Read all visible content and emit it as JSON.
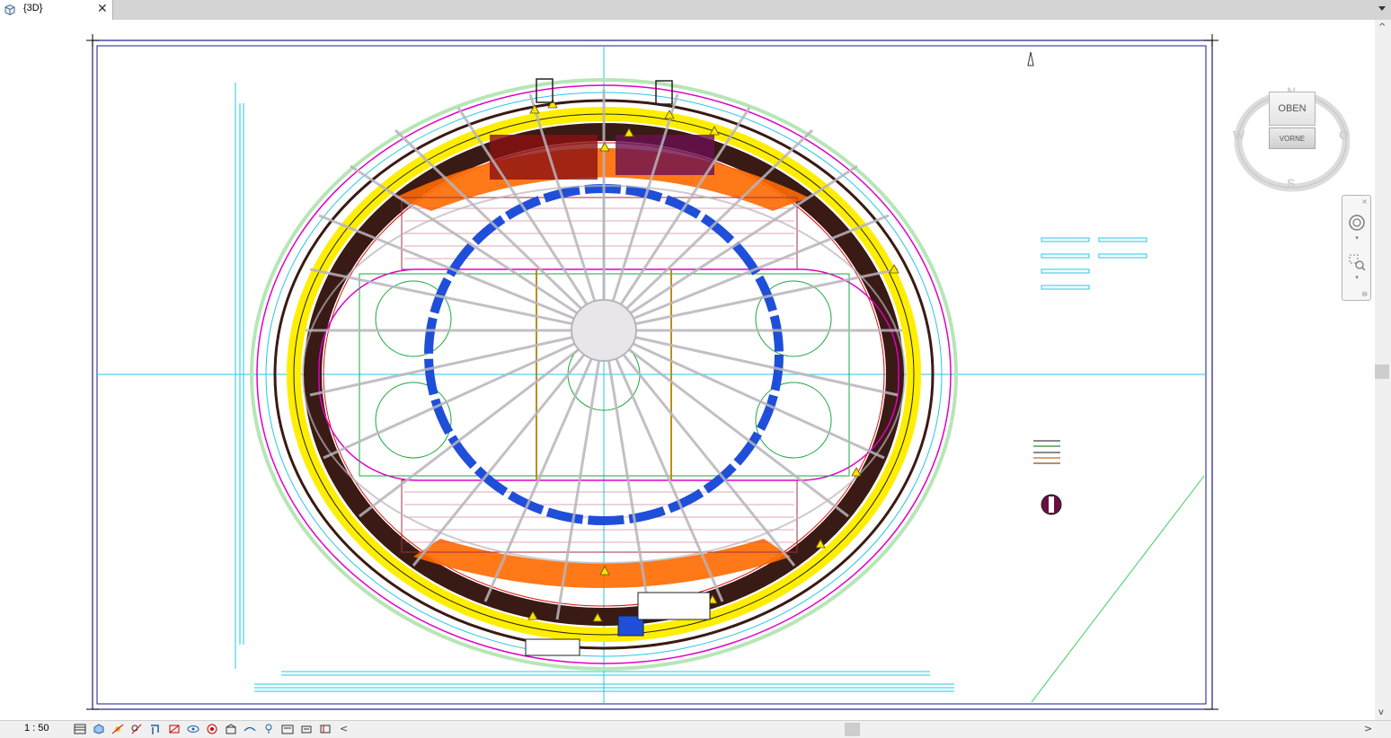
{
  "tab": {
    "title": "{3D}",
    "close_label": "✕",
    "icon": "3d-view-icon"
  },
  "view_cube": {
    "top_label": "OBEN",
    "front_label": "VORNE",
    "compass": {
      "north": "N",
      "south": "S",
      "west": "W",
      "east": "O"
    }
  },
  "nav_bar": {
    "close_label": "×",
    "min_label": "⊖"
  },
  "status_bar": {
    "scale": "1 : 50",
    "tools": [
      "detail-level-icon",
      "visual-style-icon",
      "sun-path-icon",
      "shadows-icon",
      "crop-view-icon",
      "show-crop-icon",
      "temporary-hide-icon",
      "reveal-hidden-icon",
      "worksharing-icon",
      "analytical-model-icon",
      "highlight-displacement-icon",
      "temporary-view-properties-icon",
      "reveal-constraints-icon",
      "view-template-icon"
    ],
    "scroll_left": "<",
    "scroll_right": ">"
  },
  "vscroll": {
    "up": "^",
    "down": "v"
  },
  "colors": {
    "cyan": "#22c8e8",
    "yellow": "#ffee00",
    "brown": "#3a1a14",
    "orange": "#ff6a00",
    "blue": "#1f4fd8",
    "magenta": "#e000c8",
    "green": "#1aa83c",
    "gray": "#b8b4bc",
    "frame": "#1a1a88"
  }
}
